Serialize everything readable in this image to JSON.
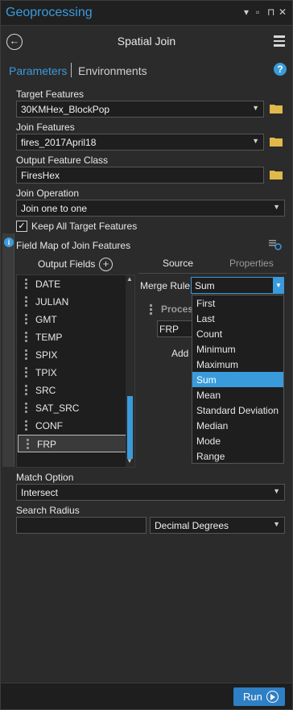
{
  "window": {
    "title": "Geoprocessing"
  },
  "header": {
    "title": "Spatial Join"
  },
  "tabs": {
    "parameters": "Parameters",
    "environments": "Environments"
  },
  "params": {
    "target_features": {
      "label": "Target Features",
      "value": "30KMHex_BlockPop"
    },
    "join_features": {
      "label": "Join Features",
      "value": "fires_2017April18"
    },
    "output_feature_class": {
      "label": "Output Feature Class",
      "value": "FiresHex"
    },
    "join_operation": {
      "label": "Join Operation",
      "value": "Join one to one"
    },
    "keep_all": {
      "label": "Keep All Target Features",
      "checked": true
    }
  },
  "field_map": {
    "label": "Field Map of Join Features",
    "output_fields_label": "Output Fields",
    "fields": [
      "DATE",
      "JULIAN",
      "GMT",
      "TEMP",
      "SPIX",
      "TPIX",
      "SRC",
      "SAT_SRC",
      "CONF",
      "FRP"
    ],
    "selected_field": "FRP",
    "source_tab": "Source",
    "properties_tab": "Properties",
    "merge_rule_label": "Merge Rule",
    "merge_rule_value": "Sum",
    "merge_rule_options": [
      "First",
      "Last",
      "Count",
      "Minimum",
      "Maximum",
      "Sum",
      "Mean",
      "Standard Deviation",
      "Median",
      "Mode",
      "Range"
    ],
    "process_label": "Proces",
    "source_field": "FRP",
    "add_label": "Add"
  },
  "match_option": {
    "label": "Match Option",
    "value": "Intersect"
  },
  "search_radius": {
    "label": "Search Radius",
    "value": "",
    "units": "Decimal Degrees"
  },
  "run": {
    "label": "Run"
  },
  "colors": {
    "accent": "#3a9bdc",
    "background": "#2b2b2b",
    "field_bg": "#1e1e1e"
  }
}
